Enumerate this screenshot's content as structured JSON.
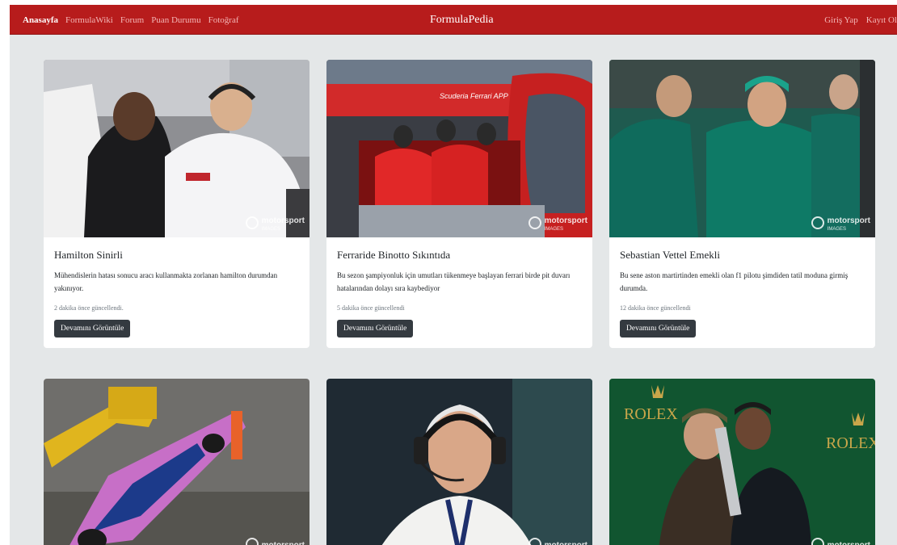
{
  "nav": {
    "links": [
      "Anasayfa",
      "FormulaWiki",
      "Forum",
      "Puan Durumu",
      "Fotoğraf"
    ],
    "brand": "FormulaPedia",
    "right": [
      "Giriş Yap",
      "Kayıt Ol"
    ]
  },
  "watermark": {
    "name": "motorsport",
    "sub": "IMAGES"
  },
  "cards": [
    {
      "title": "Hamilton Sinirli",
      "text": "Mühendislerin hatası sonucu aracı kullanmakta zorlanan hamilton durumdan yakınıyor.",
      "time": "2 dakika önce güncellendi.",
      "button": "Devamını Görüntüle",
      "image": "hamilton-engineer-photo"
    },
    {
      "title": "Ferraride Binotto Sıkıntıda",
      "text": "Bu sezon şampiyonluk için umutları tükenmeye başlayan ferrari birde pit duvarı hatalarından dolayı sıra kaybediyor",
      "time": "5 dakika önce güncellendi",
      "button": "Devamını Görüntüle",
      "image": "ferrari-pit-wall-photo",
      "photo_text": "Scuderia Ferrari APP"
    },
    {
      "title": "Sebastian Vettel Emekli",
      "text": "Bu sene aston martirtinden emekli olan f1 pilotu şimdiden tatil moduna girmiş durumda.",
      "time": "12 dakika önce güncellendi",
      "button": "Devamını Görüntüle",
      "image": "aston-martin-team-photo"
    },
    {
      "image": "alpine-car-crane-photo"
    },
    {
      "image": "race-official-headset-photo"
    },
    {
      "image": "podium-rolex-photo",
      "photo_text": "ROLEX"
    }
  ]
}
